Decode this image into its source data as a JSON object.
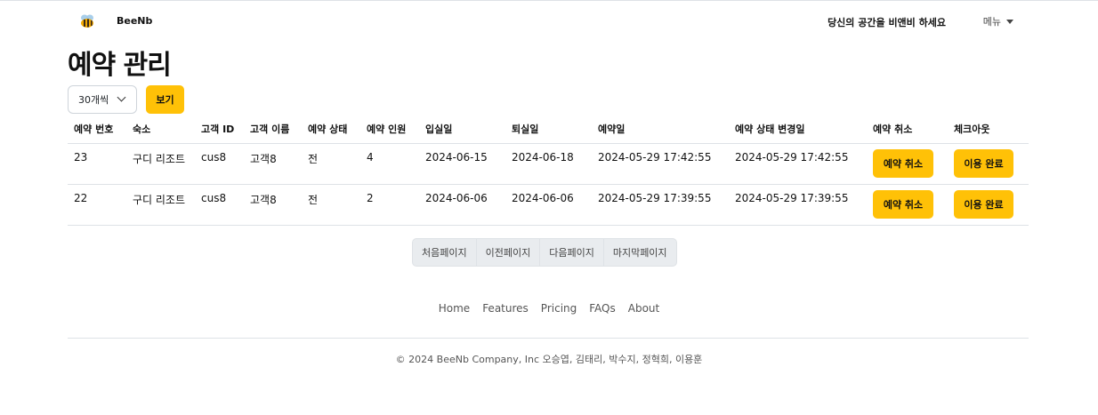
{
  "header": {
    "brand": "BeeNb",
    "slogan": "당신의 공간을 비앤비 하세요",
    "menu_label": "메뉴"
  },
  "page": {
    "title": "예약 관리"
  },
  "controls": {
    "page_size_selected": "30개씩",
    "view_label": "보기"
  },
  "table": {
    "headers": [
      "예약 번호",
      "숙소",
      "고객 ID",
      "고객 이름",
      "예약 상태",
      "예약 인원",
      "입실일",
      "퇴실일",
      "예약일",
      "예약 상태 변경일",
      "예약 취소",
      "체크아웃"
    ],
    "rows": [
      {
        "id": "23",
        "lodging": "구디 리조트",
        "customer_id": "cus8",
        "customer_name": "고객8",
        "status": "전",
        "guests": "4",
        "checkin": "2024-06-15",
        "checkout": "2024-06-18",
        "reserved_at": "2024-05-29 17:42:55",
        "status_changed_at": "2024-05-29 17:42:55",
        "cancel_label": "예약 취소",
        "done_label": "이용 완료"
      },
      {
        "id": "22",
        "lodging": "구디 리조트",
        "customer_id": "cus8",
        "customer_name": "고객8",
        "status": "전",
        "guests": "2",
        "checkin": "2024-06-06",
        "checkout": "2024-06-06",
        "reserved_at": "2024-05-29 17:39:55",
        "status_changed_at": "2024-05-29 17:39:55",
        "cancel_label": "예약 취소",
        "done_label": "이용 완료"
      }
    ]
  },
  "pagination": {
    "first": "처음페이지",
    "prev": "이전페이지",
    "next": "다음페이지",
    "last": "마지막페이지"
  },
  "footer": {
    "links": [
      "Home",
      "Features",
      "Pricing",
      "FAQs",
      "About"
    ],
    "copyright": "© 2024 BeeNb Company, Inc 오승엽, 김태리, 박수지, 정혁희, 이용훈"
  },
  "colors": {
    "accent": "#ffc107",
    "border": "#dee2e6"
  },
  "icons": {
    "logo": "bee-icon",
    "menu_caret": "caret-down-icon",
    "select_chevron": "chevron-down-icon"
  }
}
